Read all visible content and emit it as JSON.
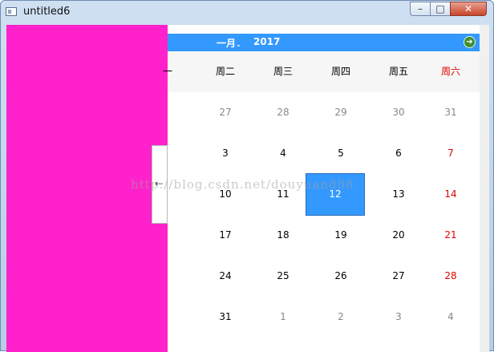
{
  "window": {
    "title": "untitled6",
    "min_glyph": "–",
    "max_glyph": "□",
    "close_glyph": "✕"
  },
  "calendar": {
    "month": "一月",
    "year": "2017",
    "next_icon": "➔",
    "headers": [
      "一",
      "周二",
      "周三",
      "周四",
      "周五",
      "周六"
    ],
    "weeks": [
      [
        "27",
        "28",
        "29",
        "30",
        "31"
      ],
      [
        "3",
        "4",
        "5",
        "6",
        "7"
      ],
      [
        "10",
        "11",
        "12",
        "13",
        "14"
      ],
      [
        "17",
        "18",
        "19",
        "20",
        "21"
      ],
      [
        "24",
        "25",
        "26",
        "27",
        "28"
      ],
      [
        "31",
        "1",
        "2",
        "3",
        "4"
      ]
    ],
    "selected": "12",
    "saturday_color": "#e00000",
    "accent": "#3399ff"
  },
  "splitter": {
    "arrow": "⇠"
  },
  "watermark": "http://blog.csdn.net/douyuan888",
  "colors": {
    "pink_panel": "#ff22cc"
  }
}
